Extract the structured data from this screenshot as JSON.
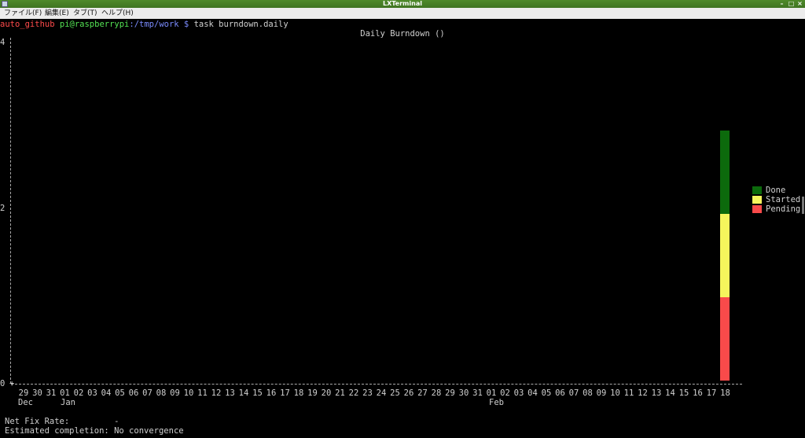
{
  "window": {
    "title": "LXTerminal",
    "minimize": "–",
    "maximize": "□",
    "close": "×"
  },
  "menu": [
    {
      "label": "ファイル(F)"
    },
    {
      "label": "編集(E)"
    },
    {
      "label": "タブ(T)"
    },
    {
      "label": "ヘルプ(H)"
    }
  ],
  "prompt": {
    "dir_name": "auto_github",
    "user_host": "pi@raspberrypi",
    "path": ":/tmp/work",
    "symbol": " $ ",
    "command": "task burndown.daily"
  },
  "chart_data": {
    "type": "bar",
    "title": "Daily Burndown ()",
    "y_ticks": [
      "4",
      "2",
      "0"
    ],
    "ylim": [
      0,
      4
    ],
    "x_days": [
      "29",
      "30",
      "31",
      "01",
      "02",
      "03",
      "04",
      "05",
      "06",
      "07",
      "08",
      "09",
      "10",
      "11",
      "12",
      "13",
      "14",
      "15",
      "16",
      "17",
      "18",
      "19",
      "20",
      "21",
      "22",
      "23",
      "24",
      "25",
      "26",
      "27",
      "28",
      "29",
      "30",
      "31",
      "01",
      "02",
      "03",
      "04",
      "05",
      "06",
      "07",
      "08",
      "09",
      "10",
      "11",
      "12",
      "13",
      "14",
      "15",
      "16",
      "17",
      "18"
    ],
    "x_months": [
      "Dec",
      "Jan",
      "Feb"
    ],
    "series": [
      {
        "name": "Pending",
        "color": "#f94a4a",
        "values_at_last_day": 1
      },
      {
        "name": "Started",
        "color": "#f5f55c",
        "values_at_last_day": 1
      },
      {
        "name": "Done",
        "color": "#0c6a0c",
        "values_at_last_day": 1
      }
    ],
    "bar_day": "18"
  },
  "legend": [
    "Done",
    "Started",
    "Pending"
  ],
  "footer": {
    "net_fix_rate_label": "Net Fix Rate:",
    "net_fix_rate_value": "-",
    "estimated_completion_label": "Estimated completion:",
    "estimated_completion_value": "No convergence"
  }
}
